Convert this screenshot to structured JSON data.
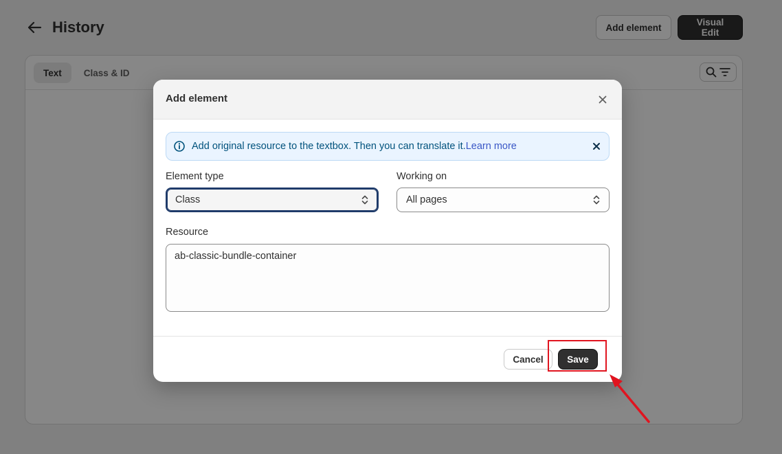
{
  "page": {
    "title": "History",
    "add_element_label": "Add element",
    "visual_edit_label": "Visual Edit",
    "tabs": [
      {
        "label": "Text",
        "active": true
      },
      {
        "label": "Class & ID",
        "active": false
      }
    ]
  },
  "modal": {
    "title": "Add element",
    "banner": {
      "text": "Add original resource to the textbox. Then you can translate it.",
      "link": "Learn more"
    },
    "element_type": {
      "label": "Element type",
      "value": "Class"
    },
    "working_on": {
      "label": "Working on",
      "value": "All pages"
    },
    "resource": {
      "label": "Resource",
      "value": "ab-classic-bundle-container"
    },
    "cancel_label": "Cancel",
    "save_label": "Save"
  },
  "icons": {
    "back": "arrow-left-icon",
    "search": "search-icon",
    "filter": "filter-icon",
    "close": "close-icon",
    "info": "info-icon",
    "chevron": "select-chevron-icon"
  },
  "colors": {
    "primary_button": "#303030",
    "banner_bg": "#eaf4ff",
    "banner_text": "#00527c",
    "link": "#3a57c6",
    "annotation": "#e0141f",
    "focus_ring": "#1f3b6a"
  }
}
